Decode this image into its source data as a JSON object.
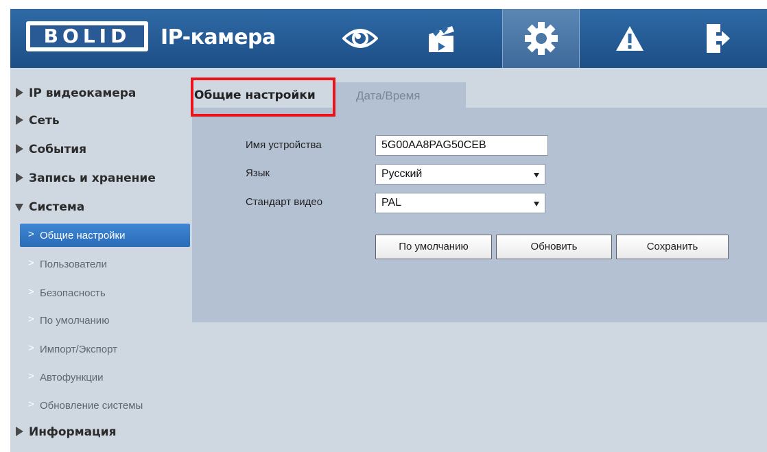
{
  "header": {
    "logo_text": "BOLID",
    "app_title": "IP-камера",
    "nav": [
      {
        "icon": "eye-icon",
        "name": "live-view"
      },
      {
        "icon": "clapperboard-icon",
        "name": "playback"
      },
      {
        "icon": "gear-icon",
        "name": "settings",
        "active": true
      },
      {
        "icon": "warning-icon",
        "name": "alarm"
      },
      {
        "icon": "logout-icon",
        "name": "logout"
      }
    ]
  },
  "sidebar": {
    "menu": [
      {
        "label": "IP видеокамера",
        "expanded": false
      },
      {
        "label": "Сеть",
        "expanded": false
      },
      {
        "label": "События",
        "expanded": false
      },
      {
        "label": "Запись и хранение",
        "expanded": false
      },
      {
        "label": "Система",
        "expanded": true
      },
      {
        "label": "Информация",
        "expanded": false
      }
    ],
    "sub_items": [
      {
        "label": "Общие настройки",
        "active": true
      },
      {
        "label": "Пользователи"
      },
      {
        "label": "Безопасность"
      },
      {
        "label": "По умолчанию"
      },
      {
        "label": "Импорт/Экспорт"
      },
      {
        "label": "Автофункции"
      },
      {
        "label": "Обновление системы"
      }
    ]
  },
  "tabs": {
    "general": "Общие настройки",
    "datetime": "Дата/Время"
  },
  "form": {
    "device_name_label": "Имя устройства",
    "device_name_value": "5G00AA8PAG50CEB",
    "language_label": "Язык",
    "language_value": "Русский",
    "video_standard_label": "Стандарт видео",
    "video_standard_value": "PAL"
  },
  "buttons": {
    "default": "По умолчанию",
    "refresh": "Обновить",
    "save": "Сохранить"
  },
  "colors": {
    "header": "#2f6aa6",
    "background": "#cfd7e1",
    "panel": "#b3c1d2",
    "active_item": "#3f86d3",
    "highlight": "#e8131b"
  }
}
